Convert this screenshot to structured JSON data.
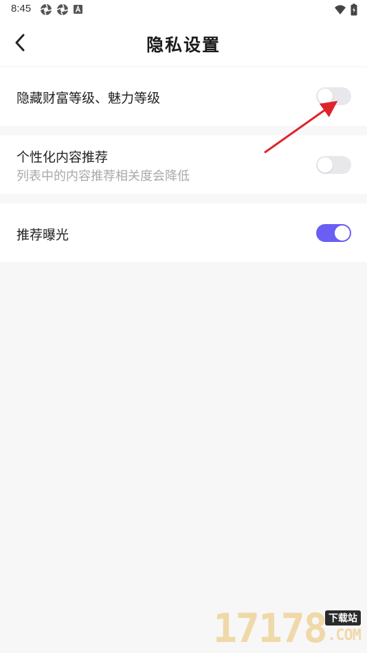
{
  "status_bar": {
    "time": "8:45",
    "left_icons": [
      "aperture-icon",
      "aperture-icon",
      "app-a-icon"
    ],
    "right_icons": [
      "wifi-icon",
      "battery-icon"
    ]
  },
  "header": {
    "title": "隐私设置",
    "back_icon": "chevron-left-icon"
  },
  "settings": [
    {
      "title": "隐藏财富等级、魅力等级",
      "subtitle": "",
      "enabled": false
    },
    {
      "title": "个性化内容推荐",
      "subtitle": "列表中的内容推荐相关度会降低",
      "enabled": false
    },
    {
      "title": "推荐曝光",
      "subtitle": "",
      "enabled": true
    }
  ],
  "colors": {
    "toggle_on": "#6a5ef5",
    "toggle_off": "#e8e8ec",
    "annotation_arrow": "#e0222a",
    "background": "#f7f7f8"
  },
  "watermark": {
    "digits": "17178",
    "badge": "下载站",
    "suffix": ".COM"
  }
}
